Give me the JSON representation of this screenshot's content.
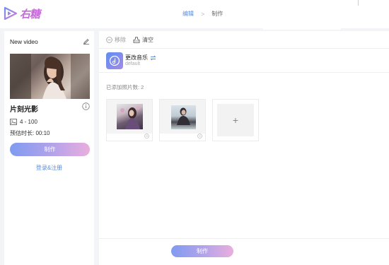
{
  "header": {
    "logo_text": "右糖",
    "steps": [
      "编辑",
      "制作"
    ],
    "step_separator": ">",
    "accent_color": "#5a8de0"
  },
  "sidebar": {
    "title": "New video",
    "template_name": "片刻光影",
    "photo_range": "4 - 100",
    "estimated_duration": "预估时长: 00:10",
    "make_button": "制作",
    "login_link": "登录&注册"
  },
  "toolbar": {
    "remove_label": "移除",
    "clear_label": "清空"
  },
  "music": {
    "title": "更改音乐",
    "subtitle": "default"
  },
  "photos": {
    "added_label": "已添加照片数: 2",
    "add_symbol": "+"
  },
  "footer": {
    "make_button": "制作"
  },
  "colors": {
    "button_gradient_start": "#7f9bf0",
    "button_gradient_end": "#eaaedd",
    "link": "#5a8de0"
  }
}
